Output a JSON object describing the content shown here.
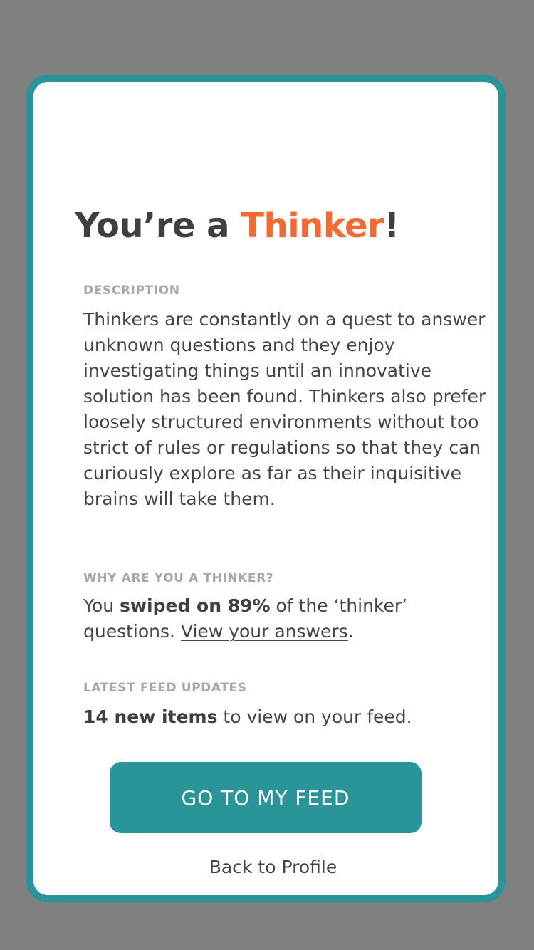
{
  "title": {
    "prefix": "You’re a ",
    "accent": "Thinker",
    "suffix": "!"
  },
  "description": {
    "label": "DESCRIPTION",
    "text": "Thinkers are constantly on a quest to answer unknown questions and they enjoy investigating things until an innovative solution has been found. Thinkers also prefer loosely structured environments without too strict of rules or regulations so that they can curiously explore as far as their inquisitive brains will take them."
  },
  "why": {
    "label": "WHY ARE YOU A THINKER?",
    "text_before": "You ",
    "bold": "swiped on 89%",
    "text_middle": " of the ‘thinker’ questions. ",
    "link": "View your answers",
    "text_after": "."
  },
  "feed_updates": {
    "label": "LATEST FEED UPDATES",
    "bold": "14 new items",
    "text": " to view on your feed."
  },
  "buttons": {
    "go_to_feed": "GO TO MY FEED",
    "back_to_profile": "Back to Profile"
  },
  "colors": {
    "accent": "#f4692f",
    "teal": "#2a9598",
    "backdrop": "#808080"
  }
}
